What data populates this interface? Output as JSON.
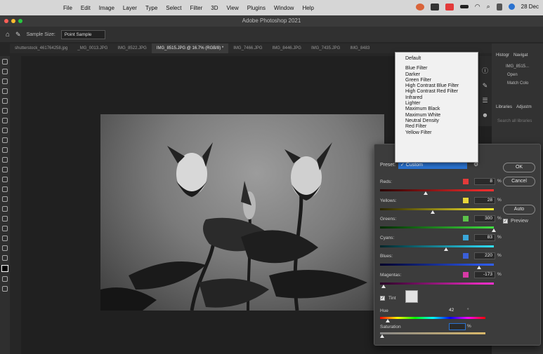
{
  "menubar": {
    "items": [
      "File",
      "Edit",
      "Image",
      "Layer",
      "Type",
      "Select",
      "Filter",
      "3D",
      "View",
      "Plugins",
      "Window",
      "Help"
    ],
    "date": "28 Dec"
  },
  "window": {
    "title": "Adobe Photoshop 2021"
  },
  "options": {
    "sample_label": "Sample Size:",
    "sample_value": "Point Sample"
  },
  "tabs": [
    "shutterstock_461764258.jpg",
    "_MG_0013.JPG",
    "IMG_8522.JPG",
    "IMG_8515.JPG @ 16.7% (RGB/8) *",
    "IMG_7466.JPG",
    "IMG_8446.JPG",
    "IMG_7435.JPG",
    "IMG_8483"
  ],
  "right_panel": {
    "tabs": [
      "Histogr",
      "Navigat"
    ],
    "history": [
      "IMG_8515...",
      "Open",
      "Match Colo"
    ],
    "tabs2": [
      "Libraries",
      "Adjustm"
    ],
    "search": "Search all libraries"
  },
  "preset_menu": {
    "default": "Default",
    "items": [
      "Blue Filter",
      "Darker",
      "Green Filter",
      "High Contrast Blue Filter",
      "High Contrast Red Filter",
      "Infrared",
      "Lighter",
      "Maximum Black",
      "Maximum White",
      "Neutral Density",
      "Red Filter",
      "Yellow Filter"
    ]
  },
  "dialog": {
    "preset_label": "Preset:",
    "preset_value": "✓ Custom",
    "sliders": [
      {
        "label": "Reds:",
        "value": "8",
        "color": "#e23a3a",
        "level": 0.4,
        "grad": "linear-gradient(90deg,#2a0000,#ff3030)"
      },
      {
        "label": "Yellows:",
        "value": "28",
        "color": "#e8d53a",
        "level": 0.46,
        "grad": "linear-gradient(90deg,#2a2600,#ffee30)"
      },
      {
        "label": "Greens:",
        "value": "300",
        "color": "#5cc24a",
        "level": 1.0,
        "grad": "linear-gradient(90deg,#002a00,#40e040)"
      },
      {
        "label": "Cyans:",
        "value": "83",
        "color": "#3aa6d8",
        "level": 0.58,
        "grad": "linear-gradient(90deg,#00262a,#30e0ff)"
      },
      {
        "label": "Blues:",
        "value": "220",
        "color": "#3a5fd8",
        "level": 0.87,
        "grad": "linear-gradient(90deg,#00002a,#3060ff)"
      },
      {
        "label": "Magentas:",
        "value": "-173",
        "color": "#d83aa6",
        "level": 0.03,
        "grad": "linear-gradient(90deg,#2a0026,#ff30d0)"
      }
    ],
    "pct": "%",
    "tint_label": "Tint",
    "hue_label": "Hue",
    "hue_value": "42",
    "hue_unit": "°",
    "saturation_label": "Saturation",
    "saturation_unit": "%",
    "buttons": {
      "ok": "OK",
      "cancel": "Cancel",
      "auto": "Auto",
      "preview": "Preview"
    }
  }
}
